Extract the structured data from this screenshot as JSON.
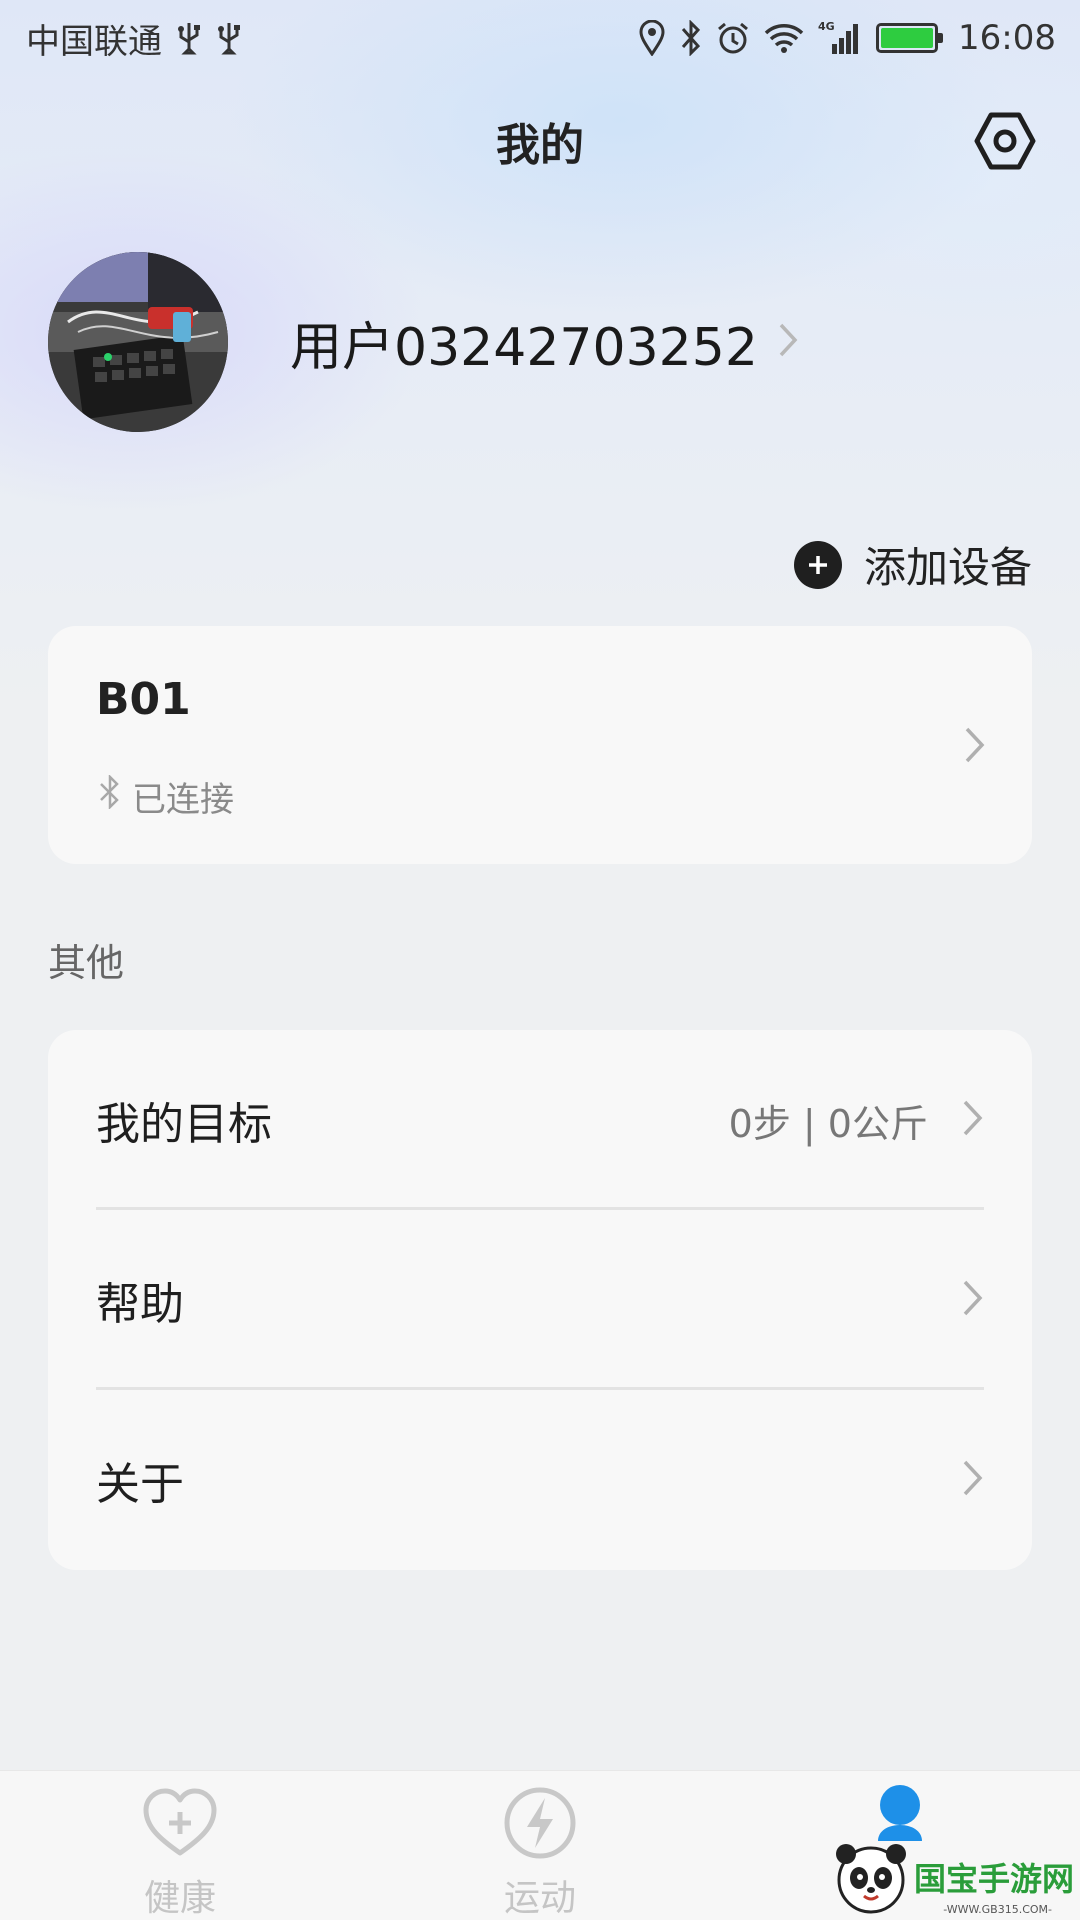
{
  "statusbar": {
    "carrier": "中国联通",
    "network": "4G",
    "time": "16:08"
  },
  "header": {
    "title": "我的"
  },
  "profile": {
    "username": "用户03242703252"
  },
  "add_device": {
    "label": "添加设备"
  },
  "device": {
    "name": "B01",
    "status": "已连接"
  },
  "section": {
    "title": "其他"
  },
  "menu": {
    "items": [
      {
        "label": "我的目标",
        "value": "0步 | 0公斤"
      },
      {
        "label": "帮助"
      },
      {
        "label": "关于"
      }
    ]
  },
  "tabs": [
    {
      "label": "健康",
      "icon": "heart-plus-icon"
    },
    {
      "label": "运动",
      "icon": "lightning-icon"
    },
    {
      "label": "",
      "icon": "person-icon",
      "active": true
    }
  ],
  "colors": {
    "active_tab": "#1e90e8",
    "battery": "#2ecc40",
    "watermark": "#2a9d3a"
  },
  "watermark": {
    "text": "国宝手游网",
    "url": "-WWW.GB315.COM-"
  }
}
